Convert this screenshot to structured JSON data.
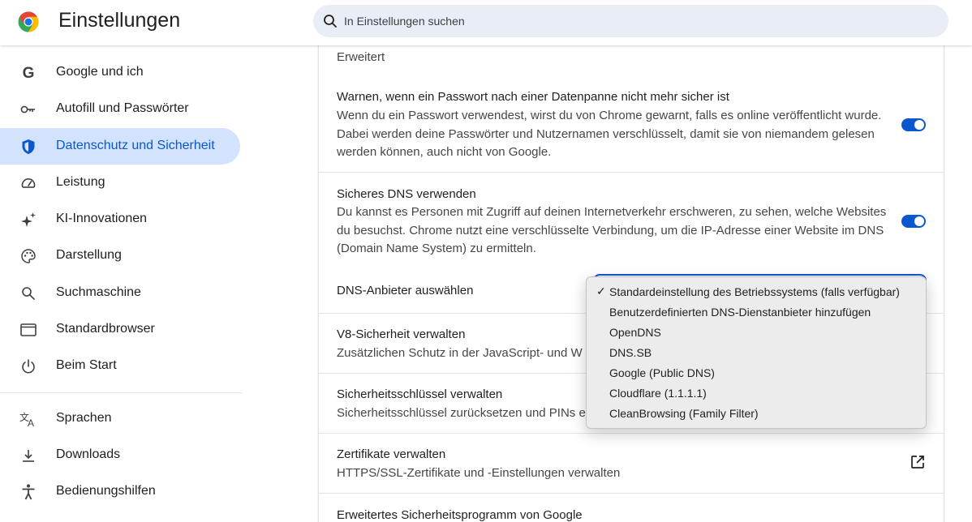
{
  "app": {
    "title": "Einstellungen"
  },
  "search": {
    "placeholder": "In Einstellungen suchen"
  },
  "sidebar": {
    "items": [
      {
        "label": "Google und ich",
        "icon": "google-g-icon"
      },
      {
        "label": "Autofill und Passwörter",
        "icon": "key-icon"
      },
      {
        "label": "Datenschutz und Sicherheit",
        "icon": "shield-icon",
        "active": true
      },
      {
        "label": "Leistung",
        "icon": "speedometer-icon"
      },
      {
        "label": "KI-Innovationen",
        "icon": "sparkle-icon"
      },
      {
        "label": "Darstellung",
        "icon": "palette-icon"
      },
      {
        "label": "Suchmaschine",
        "icon": "search-icon"
      },
      {
        "label": "Standardbrowser",
        "icon": "browser-window-icon"
      },
      {
        "label": "Beim Start",
        "icon": "power-icon"
      },
      {
        "label": "Sprachen",
        "icon": "translate-icon"
      },
      {
        "label": "Downloads",
        "icon": "download-icon"
      },
      {
        "label": "Bedienungshilfen",
        "icon": "accessibility-icon"
      }
    ]
  },
  "main": {
    "section_label": "Erweitert",
    "password_warning": {
      "title": "Warnen, wenn ein Passwort nach einer Datenpanne nicht mehr sicher ist",
      "description": "Wenn du ein Passwort verwendest, wirst du von Chrome gewarnt, falls es online veröffentlicht wurde. Dabei werden deine Passwörter und Nutzernamen verschlüsselt, damit sie von niemandem gelesen werden können, auch nicht von Google.",
      "enabled": true
    },
    "secure_dns": {
      "title": "Sicheres DNS verwenden",
      "description": "Du kannst es Personen mit Zugriff auf deinen Internetverkehr erschweren, zu sehen, welche Websites du besuchst. Chrome nutzt eine verschlüsselte Verbindung, um die IP-Adresse einer Website im DNS (Domain Name System) zu ermitteln.",
      "enabled": true,
      "provider_label": "DNS-Anbieter auswählen"
    },
    "v8": {
      "title": "V8-Sicherheit verwalten",
      "description": "Zusätzlichen Schutz in der JavaScript- und W"
    },
    "security_keys": {
      "title": "Sicherheitsschlüssel verwalten",
      "description": "Sicherheitsschlüssel zurücksetzen und PINs e"
    },
    "certificates": {
      "title": "Zertifikate verwalten",
      "description": "HTTPS/SSL-Zertifikate und -Einstellungen verwalten",
      "icon": "external-link-icon"
    },
    "advanced_protection": {
      "title": "Erweitertes Sicherheitsprogramm von Google"
    }
  },
  "dns_dropdown": {
    "selected_index": 0,
    "check_mark": "✓",
    "options": [
      "Standardeinstellung des Betriebssystems (falls verfügbar)",
      "Benutzerdefinierten DNS-Dienstanbieter hinzufügen",
      "OpenDNS",
      "DNS.SB",
      "Google (Public DNS)",
      "Cloudflare (1.1.1.1)",
      "CleanBrowsing (Family Filter)"
    ]
  },
  "colors": {
    "accent": "#0b57d0",
    "active_nav_bg": "#d3e3fd",
    "search_bg": "#e9eef6",
    "dropdown_bg": "#ececec"
  }
}
